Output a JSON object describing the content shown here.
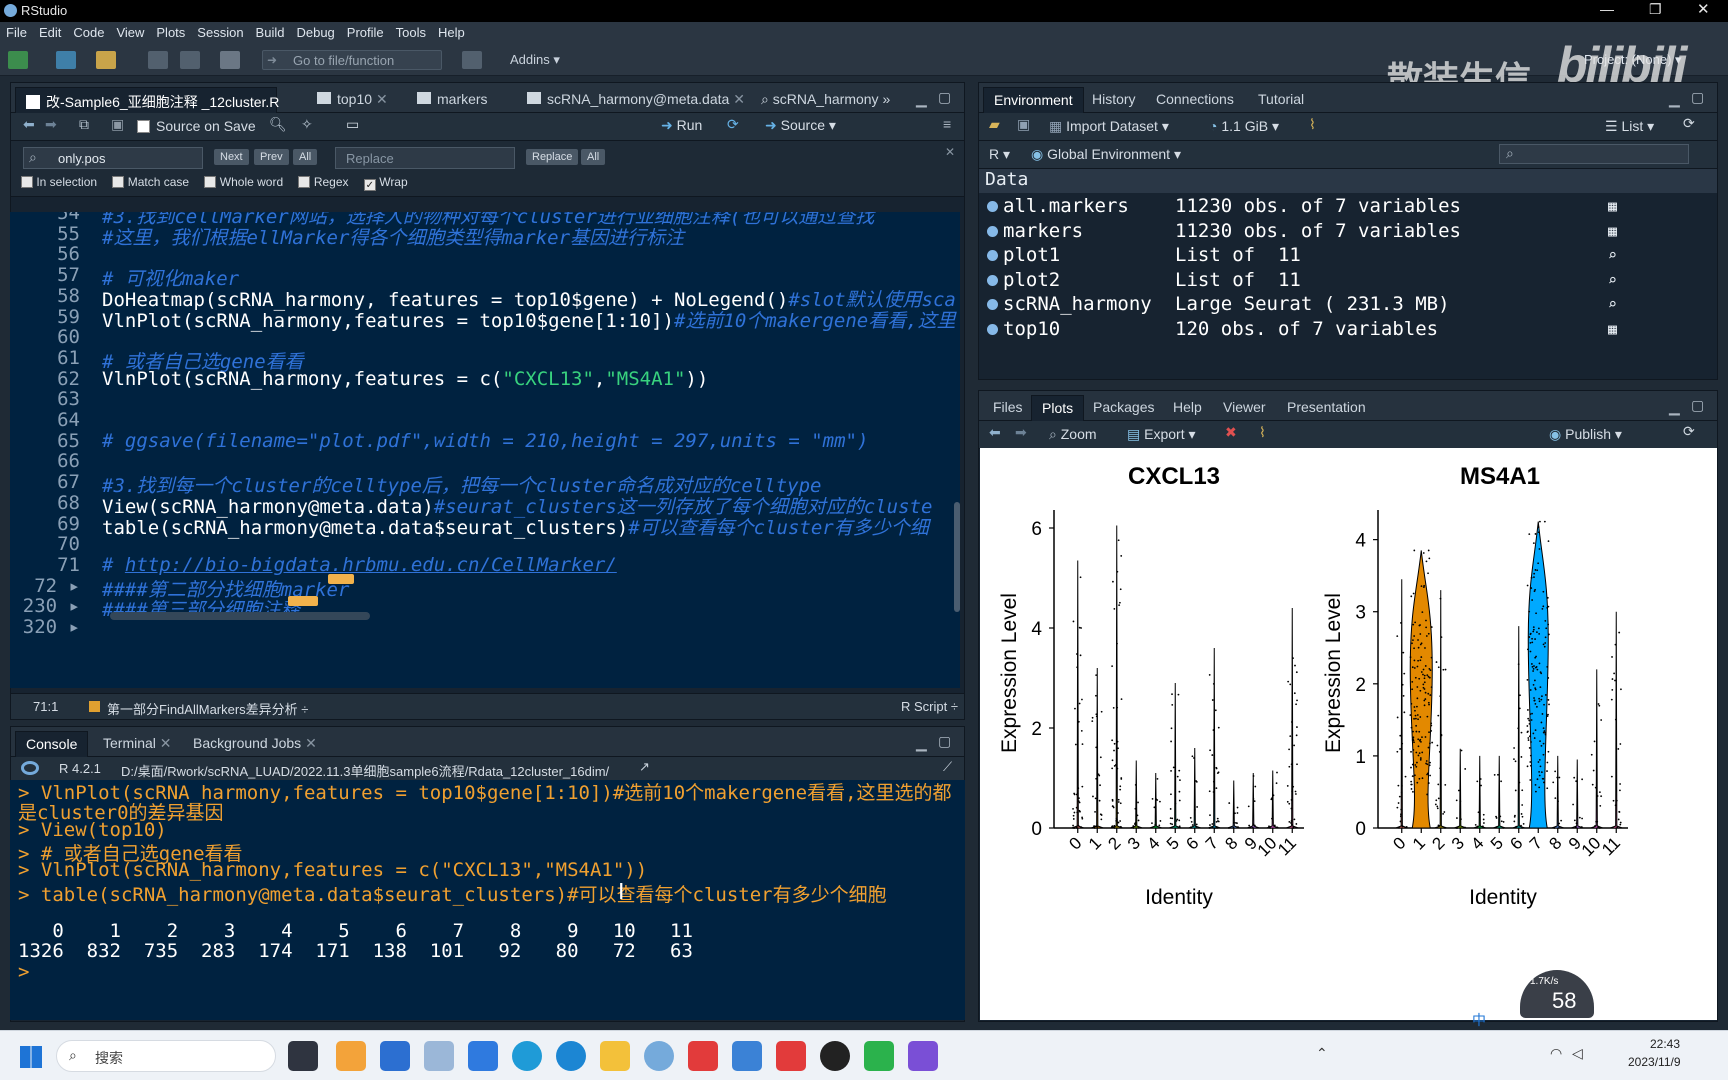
{
  "window": {
    "title": "RStudio"
  },
  "menu": [
    "File",
    "Edit",
    "Code",
    "View",
    "Plots",
    "Session",
    "Build",
    "Debug",
    "Profile",
    "Tools",
    "Help"
  ],
  "toolbar": {
    "goto_placeholder": "Go to file/function",
    "addins": "Addins",
    "project": "Project: (None)"
  },
  "watermark": {
    "text": "散装生信",
    "logo": "bilibili"
  },
  "editor": {
    "tabs": [
      "改-Sample6_亚细胞注释 _12cluster.R",
      "top10",
      "markers",
      "scRNA_harmony@meta.data",
      "scRNA_harmony"
    ],
    "source_on_save": "Source on Save",
    "run": "Run",
    "source": "Source",
    "find": {
      "value": "only.pos",
      "next": "Next",
      "prev": "Prev",
      "all": "All",
      "replace_placeholder": "Replace",
      "replace": "Replace",
      "replace_all": "All"
    },
    "options": [
      {
        "label": "In selection",
        "checked": false
      },
      {
        "label": "Match case",
        "checked": false
      },
      {
        "label": "Whole word",
        "checked": false
      },
      {
        "label": "Regex",
        "checked": false
      },
      {
        "label": "Wrap",
        "checked": true
      }
    ],
    "lines": [
      {
        "n": "54",
        "segs": [
          {
            "t": "#3.找到cellMarker网站，选择人的物种对每个cluster进行亚细胞注释(也可以通过查找",
            "c": "cm"
          }
        ]
      },
      {
        "n": "55",
        "segs": [
          {
            "t": "#这里，我们根据ellMarker得各个细胞类型得marker基因进行标注",
            "c": "cm"
          }
        ]
      },
      {
        "n": "56",
        "segs": []
      },
      {
        "n": "57",
        "segs": [
          {
            "t": "# 可视化maker",
            "c": "cm"
          }
        ]
      },
      {
        "n": "58",
        "segs": [
          {
            "t": "DoHeatmap(scRNA_harmony, features = top10$gene) + NoLegend()",
            "c": ""
          },
          {
            "t": "#slot默认使用sca",
            "c": "cm"
          }
        ]
      },
      {
        "n": "59",
        "segs": [
          {
            "t": "VlnPlot(scRNA_harmony,features = top10$gene[1:10])",
            "c": ""
          },
          {
            "t": "#选前10个makergene看看,这里",
            "c": "cm"
          }
        ]
      },
      {
        "n": "60",
        "segs": []
      },
      {
        "n": "61",
        "segs": [
          {
            "t": "# 或者自己选gene看看",
            "c": "cm"
          }
        ]
      },
      {
        "n": "62",
        "segs": [
          {
            "t": "VlnPlot(scRNA_harmony,features = c(",
            "c": ""
          },
          {
            "t": "\"CXCL13\"",
            "c": "str"
          },
          {
            "t": ",",
            "c": ""
          },
          {
            "t": "\"MS4A1\"",
            "c": "str"
          },
          {
            "t": "))",
            "c": ""
          }
        ]
      },
      {
        "n": "63",
        "segs": []
      },
      {
        "n": "64",
        "segs": []
      },
      {
        "n": "65",
        "segs": [
          {
            "t": "# ggsave(filename=\"plot.pdf\",width = 210,height = 297,units = \"mm\")",
            "c": "cm"
          }
        ]
      },
      {
        "n": "66",
        "segs": []
      },
      {
        "n": "67",
        "segs": [
          {
            "t": "#3.找到每一个cluster的celltype后，把每一个cluster命名成对应的celltype",
            "c": "cm"
          }
        ]
      },
      {
        "n": "68",
        "segs": [
          {
            "t": "View(scRNA_harmony@meta.data)",
            "c": ""
          },
          {
            "t": "#seurat_clusters这一列存放了每个细胞对应的cluste",
            "c": "cm"
          }
        ]
      },
      {
        "n": "69",
        "segs": [
          {
            "t": "table(scRNA_harmony@meta.data$seurat_clusters)",
            "c": ""
          },
          {
            "t": "#可以查看每个cluster有多少个细",
            "c": "cm"
          }
        ]
      },
      {
        "n": "70",
        "segs": []
      },
      {
        "n": "71",
        "segs": [
          {
            "t": "# ",
            "c": "cm"
          },
          {
            "t": "http://bio-bigdata.hrbmu.edu.cn/CellMarker/",
            "c": "url"
          }
        ]
      },
      {
        "n": "72 ▸",
        "segs": [
          {
            "t": "####第二部分找细胞marker",
            "c": "cm"
          }
        ]
      },
      {
        "n": "230 ▸",
        "segs": [
          {
            "t": "####第三部分细胞注释",
            "c": "cm"
          }
        ]
      },
      {
        "n": "320 ▸",
        "segs": []
      }
    ],
    "status": {
      "position": "71:1",
      "section": "第一部分FindAllMarkers差异分析 ÷",
      "filetype": "R Script ÷"
    }
  },
  "console": {
    "tabs": [
      "Console",
      "Terminal",
      "Background Jobs"
    ],
    "r_version": "R 4.2.1",
    "path": "D:/桌面/Rwork/scRNA_LUAD/2022.11.3单细胞sample6流程/Rdata_12cluster_16dim/",
    "lines": [
      {
        "t": "> VlnPlot(scRNA_harmony,features = top10$gene[1:10])#选前10个makergene看看,这里选的都",
        "c": ""
      },
      {
        "t": "是cluster0的差异基因",
        "c": ""
      },
      {
        "t": "> View(top10)",
        "c": ""
      },
      {
        "t": "> # 或者自己选gene看看",
        "c": ""
      },
      {
        "t": "> VlnPlot(scRNA_harmony,features = c(\"CXCL13\",\"MS4A1\"))",
        "c": ""
      },
      {
        "t": "> table(scRNA_harmony@meta.data$seurat_clusters)#可以查看每个cluster有多少个细胞",
        "c": ""
      },
      {
        "t": "",
        "c": ""
      },
      {
        "t": "   0    1    2    3    4    5    6    7    8    9   10   11 ",
        "c": "co"
      },
      {
        "t": "1326  832  735  283  174  171  138  101   92   80   72   63 ",
        "c": "co"
      },
      {
        "t": ">",
        "c": ""
      }
    ]
  },
  "environment": {
    "tabs": [
      "Environment",
      "History",
      "Connections",
      "Tutorial"
    ],
    "import_dataset": "Import Dataset",
    "memory": "1.1 GiB",
    "list_view": "List",
    "lang": "R",
    "scope": "Global Environment",
    "section": "Data",
    "rows": [
      {
        "name": "all.markers",
        "value": "11230 obs. of 7 variables"
      },
      {
        "name": "markers",
        "value": "11230 obs. of 7 variables"
      },
      {
        "name": "plot1",
        "value": "List of  11"
      },
      {
        "name": "plot2",
        "value": "List of  11"
      },
      {
        "name": "scRNA_harmony",
        "value": "Large Seurat ( 231.3 MB)"
      },
      {
        "name": "top10",
        "value": "120 obs. of 7 variables"
      }
    ]
  },
  "plots_pane": {
    "tabs": [
      "Files",
      "Plots",
      "Packages",
      "Help",
      "Viewer",
      "Presentation"
    ],
    "zoom": "Zoom",
    "export": "Export",
    "publish": "Publish"
  },
  "chart_data": [
    {
      "type": "violin",
      "title": "CXCL13",
      "xlabel": "Identity",
      "ylabel": "Expression Level",
      "categories": [
        "0",
        "1",
        "2",
        "3",
        "4",
        "5",
        "6",
        "7",
        "8",
        "9",
        "10",
        "11"
      ],
      "ylim": [
        0,
        6.2
      ],
      "yticks": [
        0,
        2,
        4,
        6
      ],
      "max_values": [
        5.35,
        3.2,
        6.05,
        1.35,
        1.1,
        2.9,
        1.6,
        3.6,
        0.95,
        1.1,
        1.15,
        4.4
      ],
      "colors": [
        "#F8766D",
        "#DE8C00",
        "#B79F00",
        "#7CAE00",
        "#00BA38",
        "#00C08B",
        "#00BFC4",
        "#00B4F0",
        "#619CFF",
        "#C77CFF",
        "#F564E3",
        "#FF64B0"
      ]
    },
    {
      "type": "violin",
      "title": "MS4A1",
      "xlabel": "Identity",
      "ylabel": "Expression Level",
      "categories": [
        "0",
        "1",
        "2",
        "3",
        "4",
        "5",
        "6",
        "7",
        "8",
        "9",
        "10",
        "11"
      ],
      "ylim": [
        0,
        4.3
      ],
      "yticks": [
        0,
        1,
        2,
        3,
        4
      ],
      "max_values": [
        3.45,
        3.85,
        3.3,
        1.1,
        1.0,
        1.0,
        2.8,
        4.25,
        1.0,
        0.95,
        2.2,
        3.0
      ],
      "colors": [
        "#F8766D",
        "#DE8C00",
        "#B79F00",
        "#7CAE00",
        "#00BA38",
        "#00C08B",
        "#00BFC4",
        "#00B4F0",
        "#619CFF",
        "#C77CFF",
        "#F564E3",
        "#FF64B0"
      ]
    }
  ],
  "taskbar": {
    "search": "搜索",
    "time": "22:43",
    "date": "2023/11/9",
    "ime": "中",
    "cpu_gauge": "58",
    "net_speed": "1.7K/s"
  }
}
